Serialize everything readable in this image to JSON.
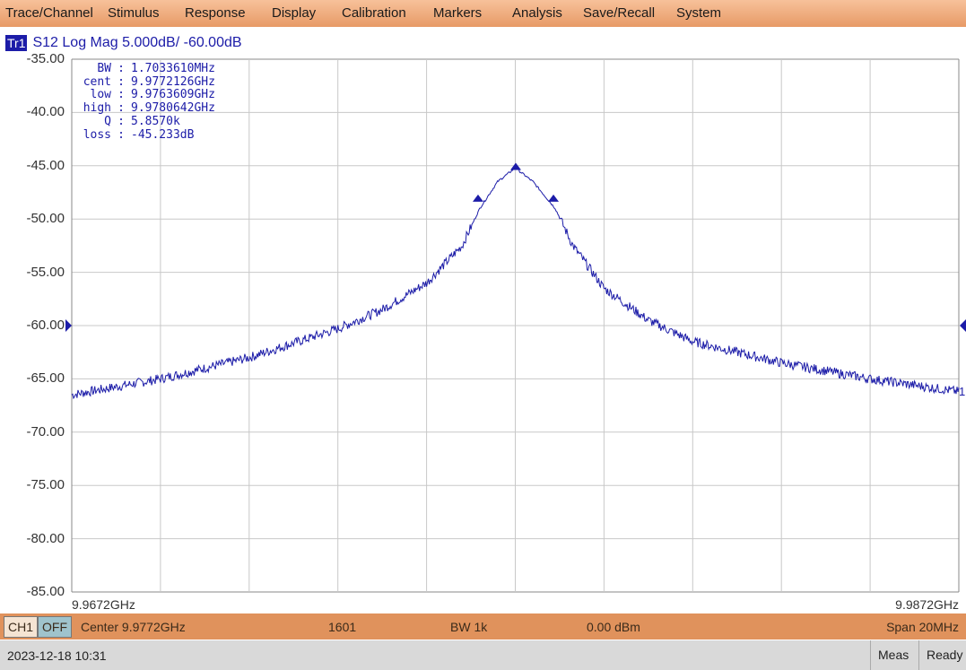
{
  "menu": [
    "Trace/Channel",
    "Stimulus",
    "Response",
    "Display",
    "Calibration",
    "Markers",
    "Analysis",
    "Save/Recall",
    "System"
  ],
  "trace": {
    "badge": "Tr1",
    "title": "S12 Log Mag 5.000dB/ -60.00dB"
  },
  "y_ticks": [
    "-35.00",
    "-40.00",
    "-45.00",
    "-50.00",
    "-55.00",
    "-60.00",
    "-65.00",
    "-70.00",
    "-75.00",
    "-80.00",
    "-85.00"
  ],
  "x_start": "9.9672GHz",
  "x_stop": "9.9872GHz",
  "marker_readout": [
    {
      "label": "BW",
      "value": "1.7033610MHz"
    },
    {
      "label": "cent",
      "value": "9.9772126GHz"
    },
    {
      "label": "low",
      "value": "9.9763609GHz"
    },
    {
      "label": "high",
      "value": "9.9780642GHz"
    },
    {
      "label": "Q",
      "value": "5.8570k"
    },
    {
      "label": "loss",
      "value": "-45.233dB"
    }
  ],
  "trace_end_label": "1",
  "colors": {
    "trace": "#1c1ca8",
    "menubar": "#eca070",
    "statusbar": "#e0925c",
    "grid": "#c8c8c8"
  },
  "status": {
    "channel": "CH1",
    "off": "OFF",
    "center": "Center 9.9772GHz",
    "points": "1601",
    "bw": "BW 1k",
    "power": "0.00 dBm",
    "span": "Span 20MHz"
  },
  "bottom": {
    "datetime": "2023-12-18 10:31",
    "meas": "Meas",
    "ready": "Ready"
  },
  "chart_data": {
    "type": "line",
    "title": "S12 Log Mag 5.000dB/ -60.00dB",
    "xlim": [
      9.9672,
      9.9872
    ],
    "ylim": [
      -85,
      -35
    ],
    "x_unit": "GHz",
    "y_unit": "dB",
    "reference_level": -60,
    "series": [
      {
        "x": [
          9.9672,
          9.9692,
          9.9712,
          9.9732,
          9.9742,
          9.9752,
          9.976,
          9.9764,
          9.9768,
          9.9772,
          9.9776,
          9.9781,
          9.9785,
          9.9792,
          9.9802,
          9.9812,
          9.9832,
          9.9852,
          9.9872
        ],
        "values": [
          -66.5,
          -65.0,
          -63.0,
          -60.3,
          -58.5,
          -56.0,
          -52.5,
          -49.0,
          -46.5,
          -45.2,
          -46.5,
          -49.0,
          -52.5,
          -56.5,
          -59.5,
          -61.5,
          -63.5,
          -65.0,
          -66.2
        ]
      }
    ],
    "markers": [
      {
        "x": 9.97636,
        "y": -48.2
      },
      {
        "x": 9.97721,
        "y": -45.23
      },
      {
        "x": 9.97806,
        "y": -48.2
      }
    ]
  }
}
